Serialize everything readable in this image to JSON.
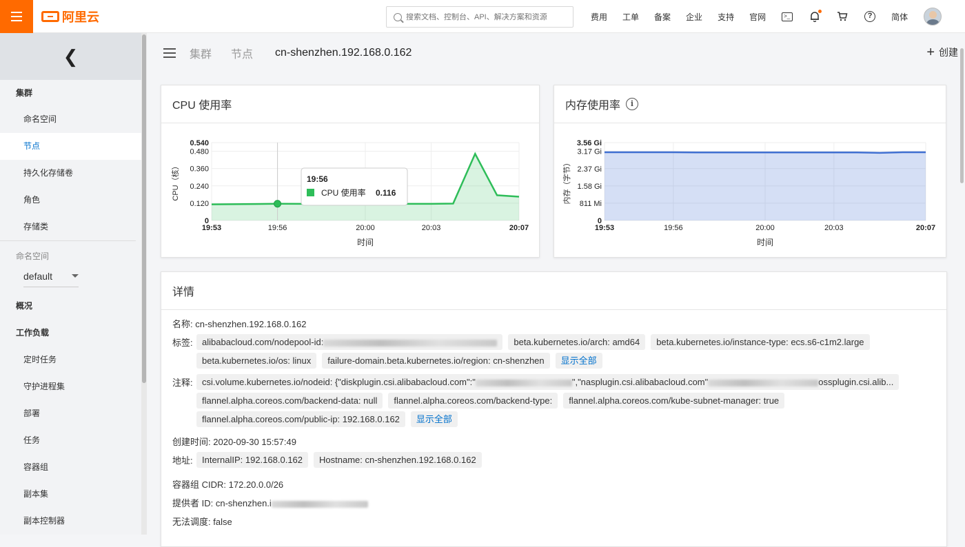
{
  "topbar": {
    "brand": "阿里云",
    "search_placeholder": "搜索文档、控制台、API、解决方案和资源",
    "nav": [
      "费用",
      "工单",
      "备案",
      "企业",
      "支持",
      "官网"
    ],
    "lang": "简体"
  },
  "sidebar": {
    "group_cluster": "集群",
    "cluster_items": [
      "命名空间",
      "节点",
      "持久化存储卷",
      "角色",
      "存储类"
    ],
    "namespace_label": "命名空间",
    "namespace_value": "default",
    "overview": "概况",
    "workload_group": "工作负载",
    "workload_items": [
      "定时任务",
      "守护进程集",
      "部署",
      "任务",
      "容器组",
      "副本集",
      "副本控制器"
    ]
  },
  "breadcrumb": {
    "cluster": "集群",
    "node": "节点",
    "current": "cn-shenzhen.192.168.0.162"
  },
  "create_label": "创建",
  "cpu_card": {
    "title": "CPU 使用率",
    "tooltip_time": "19:56",
    "tooltip_label": "CPU 使用率",
    "tooltip_value": "0.116"
  },
  "mem_card": {
    "title": "内存使用率",
    "info_icon": "info-icon"
  },
  "chart_data": [
    {
      "type": "area",
      "title": "CPU 使用率",
      "xlabel": "时间",
      "ylabel": "CPU（核）",
      "xticks": [
        "19:53",
        "19:56",
        "20:00",
        "20:03",
        "20:07"
      ],
      "yticks": [
        "0",
        "0.120",
        "0.240",
        "0.360",
        "0.480",
        "0.540"
      ],
      "ylim": [
        0,
        0.54
      ],
      "xlim": [
        "19:53",
        "20:07"
      ],
      "x": [
        "19:53",
        "19:54",
        "19:55",
        "19:56",
        "19:57",
        "19:58",
        "19:59",
        "20:00",
        "20:01",
        "20:02",
        "20:03",
        "20:04",
        "20:05",
        "20:06",
        "20:07"
      ],
      "values": [
        0.112,
        0.113,
        0.114,
        0.116,
        0.115,
        0.114,
        0.115,
        0.116,
        0.115,
        0.115,
        0.115,
        0.117,
        0.462,
        0.175,
        0.165
      ],
      "color": "#2ebd59",
      "grid": true
    },
    {
      "type": "area",
      "title": "内存使用率",
      "xlabel": "时间",
      "ylabel": "内存（字节）",
      "xticks": [
        "19:53",
        "19:56",
        "20:00",
        "20:03",
        "20:07"
      ],
      "yticks": [
        "0",
        "811 Mi",
        "1.58 Gi",
        "2.37 Gi",
        "3.17 Gi",
        "3.56 Gi"
      ],
      "ylim": [
        0,
        3.56
      ],
      "xlim": [
        "19:53",
        "20:07"
      ],
      "x": [
        "19:53",
        "19:54",
        "19:55",
        "19:56",
        "19:57",
        "19:58",
        "19:59",
        "20:00",
        "20:01",
        "20:02",
        "20:03",
        "20:04",
        "20:05",
        "20:06",
        "20:07"
      ],
      "values_gi": [
        3.12,
        3.12,
        3.12,
        3.12,
        3.11,
        3.11,
        3.11,
        3.11,
        3.11,
        3.11,
        3.11,
        3.11,
        3.09,
        3.12,
        3.12
      ],
      "color": "#3f6fd1",
      "grid": true
    }
  ],
  "details": {
    "title": "详情",
    "name_label": "名称:",
    "name_value": "cn-shenzhen.192.168.0.162",
    "labels_label": "标签:",
    "labels_row1": [
      "alibabacloud.com/nodepool-id:",
      "beta.kubernetes.io/arch: amd64",
      "beta.kubernetes.io/instance-type: ecs.s6-c1m2.large"
    ],
    "labels_row2": [
      "beta.kubernetes.io/os: linux",
      "failure-domain.beta.kubernetes.io/region: cn-shenzhen"
    ],
    "show_all": "显示全部",
    "annotations_label": "注释:",
    "ann_row1": "csi.volume.kubernetes.io/nodeid:  {\"diskplugin.csi.alibabacloud.com\":\"",
    "ann_row1_b": "\",\"nasplugin.csi.alibabacloud.com\"",
    "ann_row1_c": "ossplugin.csi.alib...",
    "ann_row2": [
      "flannel.alpha.coreos.com/backend-data:  null",
      "flannel.alpha.coreos.com/backend-type:",
      "flannel.alpha.coreos.com/kube-subnet-manager:  true"
    ],
    "ann_row3": "flannel.alpha.coreos.com/public-ip:  192.168.0.162",
    "created_label": "创建时间:",
    "created_value": "2020-09-30 15:57:49",
    "address_label": "地址:",
    "addresses": [
      "InternalIP: 192.168.0.162",
      "Hostname: cn-shenzhen.192.168.0.162"
    ],
    "cidr_label": "容器组 CIDR:",
    "cidr_value": "172.20.0.0/26",
    "provider_label": "提供者 ID:",
    "provider_value": "cn-shenzhen.i",
    "unsched_label": "无法调度:",
    "unsched_value": "false"
  }
}
